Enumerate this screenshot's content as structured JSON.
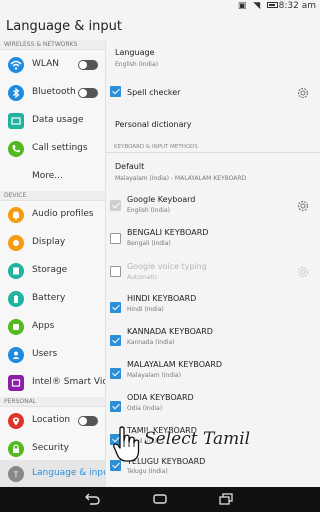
{
  "status_bar": {
    "time": "8:32 am"
  },
  "title_bar": {
    "title": "Language & input"
  },
  "sidebar": {
    "sections": [
      {
        "header": "WIRELESS & NETWORKS"
      },
      {
        "header": "DEVICE"
      },
      {
        "header": "PERSONAL"
      }
    ],
    "items": [
      {
        "label": "WLAN",
        "icon": "wifi-icon",
        "color": "#1e8be0"
      },
      {
        "label": "Bluetooth",
        "icon": "bluetooth-icon",
        "color": "#1e8be0"
      },
      {
        "label": "Data usage",
        "icon": "data-usage-icon",
        "color": "#1fb3a0"
      },
      {
        "label": "Call settings",
        "icon": "phone-icon",
        "color": "#55b81e"
      },
      {
        "label": "More...",
        "icon": "",
        "color": ""
      },
      {
        "label": "Audio profiles",
        "icon": "bell-icon",
        "color": "#f59c11"
      },
      {
        "label": "Display",
        "icon": "display-icon",
        "color": "#f59c11"
      },
      {
        "label": "Storage",
        "icon": "storage-icon",
        "color": "#1fb3a0"
      },
      {
        "label": "Battery",
        "icon": "battery-icon",
        "color": "#1fb3a0"
      },
      {
        "label": "Apps",
        "icon": "apps-icon",
        "color": "#55b81e"
      },
      {
        "label": "Users",
        "icon": "users-icon",
        "color": "#1e8be0"
      },
      {
        "label": "Intel® Smart Vid",
        "icon": "intel-icon",
        "color": "#8c1fa8"
      },
      {
        "label": "Location",
        "icon": "location-icon",
        "color": "#e0322b"
      },
      {
        "label": "Security",
        "icon": "lock-icon",
        "color": "#55b81e"
      },
      {
        "label": "Language & inpu",
        "icon": "language-icon",
        "color": "#888888"
      }
    ]
  },
  "content": {
    "language": {
      "title": "Language",
      "value": "English (India)"
    },
    "spell_checker": {
      "title": "Spell checker",
      "checked": true
    },
    "personal_dictionary": {
      "title": "Personal dictionary"
    },
    "section_header": "KEYBOARD & INPUT METHODS",
    "default": {
      "title": "Default",
      "value": "Malayalam (India) - MALAYALAM KEYBOARD"
    },
    "keyboards": [
      {
        "title": "Google Keyboard",
        "sub": "English (India)",
        "state": "disabled-checked",
        "enabled": true,
        "gear": true
      },
      {
        "title": "BENGALI KEYBOARD",
        "sub": "Bengali (India)",
        "state": "unchecked",
        "enabled": true,
        "gear": false
      },
      {
        "title": "Google voice typing",
        "sub": "Automatic",
        "state": "unchecked",
        "enabled": false,
        "gear": true
      },
      {
        "title": "HINDI KEYBOARD",
        "sub": "Hindi (India)",
        "state": "checked",
        "enabled": true,
        "gear": false
      },
      {
        "title": "KANNADA KEYBOARD",
        "sub": "Kannada (India)",
        "state": "checked",
        "enabled": true,
        "gear": false
      },
      {
        "title": "MALAYALAM KEYBOARD",
        "sub": "Malayalam (India)",
        "state": "checked",
        "enabled": true,
        "gear": false
      },
      {
        "title": "ODIA KEYBOARD",
        "sub": "Odia (India)",
        "state": "checked",
        "enabled": true,
        "gear": false
      },
      {
        "title": "TAMIL KEYBOARD",
        "sub": "Tamil (India)",
        "state": "checked",
        "enabled": true,
        "gear": false
      },
      {
        "title": "TELUGU KEYBOARD",
        "sub": "Telugu (India)",
        "state": "checked",
        "enabled": true,
        "gear": false
      }
    ]
  },
  "annotation": {
    "text": "Select Tamil"
  },
  "colors": {
    "accent": "#2b8ed6",
    "navbar": "#111111"
  }
}
